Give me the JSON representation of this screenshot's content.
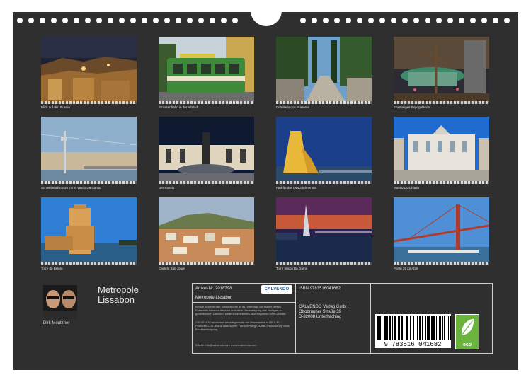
{
  "calendar": {
    "title_line1": "Metropole",
    "title_line2": "Lissabon",
    "author": "Dirk Meutzner"
  },
  "photos": [
    {
      "caption": "Blick auf den Rossio"
    },
    {
      "caption": "Strassenbahn in der Altstadt"
    },
    {
      "caption": "Cemiterio dos Prazeres"
    },
    {
      "caption": "Ehemaliges Expogelände"
    },
    {
      "caption": "Schwebebahn zum Torre Vasco Da Gama"
    },
    {
      "caption": "Der Rossio"
    },
    {
      "caption": "Padrão dos Descobrimentos"
    },
    {
      "caption": "Museu Do Chiado"
    },
    {
      "caption": "Torre de Belém"
    },
    {
      "caption": "Castelo Saö Jorge"
    },
    {
      "caption": "Torre Vasco Da Gama"
    },
    {
      "caption": "Ponte 25 de Abril"
    }
  ],
  "info": {
    "article": "Artikel-Nr. 2018798",
    "logo": "CALVENDO",
    "product_title": "Metropole Lissabon",
    "legal": "Infolge bestehender Schutzrechte ist es untersagt, die Blätter dieses Kalenders herauszutrennen und ohne Genehmigung des Verlages zu gewerblichen Zwecken weiterzuverarbeiten. Alle Angaben ohne Gewähr.",
    "production": "CALVENDO produziert bedarfsgerecht und klimaneutral in DE & EU. Positives CO2-Bilanz dank kurzer Transportwege, Abfall-Reduzierung dank Einzelanfertigung.",
    "contact": "E-Mail: info@calvendo.com • www.calvendo.com",
    "isbn": "ISBN 9783516041682",
    "publisher_name": "CALVENDO Verlag GmbH",
    "publisher_street": "Ottobrunner Straße 39",
    "publisher_city": "D-82008 Unterhaching",
    "barcode_digits": "9 783516 041682",
    "eco_label": "eco"
  },
  "colors": {
    "background": "#2f2f2f",
    "eco_green": "#6ab33c",
    "calvendo_blue": "#1d5aa6"
  }
}
